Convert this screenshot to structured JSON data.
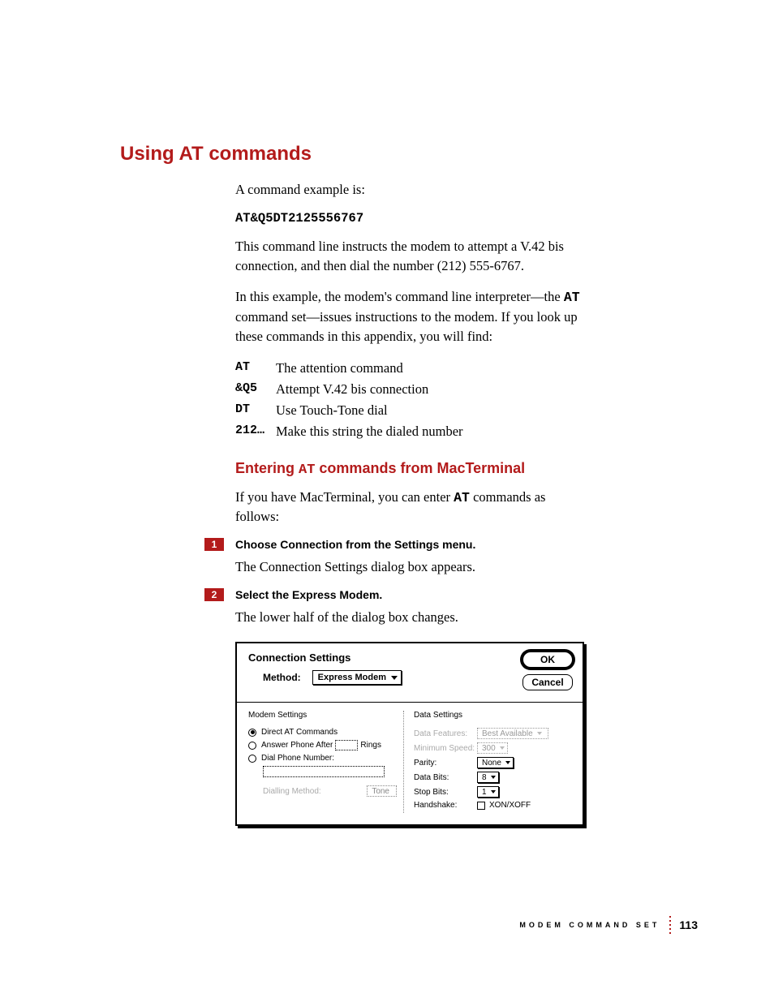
{
  "heading": "Using AT commands",
  "intro_para": "A command example is:",
  "command_example": "AT&Q5DT2125556767",
  "explain_para": "This command line instructs the modem to attempt a V.42 bis connection, and then dial the number (212) 555-6767.",
  "interpreter_para_pre": "In this example, the modem's command line interpreter—the ",
  "interpreter_code": "AT",
  "interpreter_para_post": " command set—issues instructions to the modem. If you look up these commands in this appendix, you will find:",
  "defs": [
    {
      "key": "AT",
      "val": "The attention command"
    },
    {
      "key": "&Q5",
      "val": "Attempt V.42 bis connection"
    },
    {
      "key": "DT",
      "val": "Use Touch-Tone dial"
    },
    {
      "key": "212…",
      "val": "Make this string the dialed number"
    }
  ],
  "subheading_pre": "Entering ",
  "subheading_code": "AT",
  "subheading_post": " commands from MacTerminal",
  "sub_para_pre": "If you have MacTerminal, you can enter ",
  "sub_para_code": "AT",
  "sub_para_post": " commands as follows:",
  "steps": [
    {
      "num": "1",
      "text": "Choose Connection from the Settings menu.",
      "after": "The Connection Settings dialog box appears."
    },
    {
      "num": "2",
      "text": "Select the Express Modem.",
      "after": "The lower half of the dialog box changes."
    }
  ],
  "dialog": {
    "title": "Connection Settings",
    "ok": "OK",
    "cancel": "Cancel",
    "method_label": "Method:",
    "method_value": "Express Modem",
    "modem_section": "Modem Settings",
    "data_section": "Data Settings",
    "opt_direct": "Direct AT Commands",
    "opt_answer_pre": "Answer Phone After",
    "opt_answer_post": "Rings",
    "opt_dial": "Dial Phone Number:",
    "dialling_label": "Dialling Method:",
    "dialling_value": "Tone",
    "data_features_label": "Data Features:",
    "data_features_value": "Best Available",
    "min_speed_label": "Minimum Speed:",
    "min_speed_value": "300",
    "parity_label": "Parity:",
    "parity_value": "None",
    "databits_label": "Data Bits:",
    "databits_value": "8",
    "stopbits_label": "Stop Bits:",
    "stopbits_value": "1",
    "handshake_label": "Handshake:",
    "handshake_value": "XON/XOFF"
  },
  "footer_text": "Modem Command Set",
  "page_number": "113"
}
